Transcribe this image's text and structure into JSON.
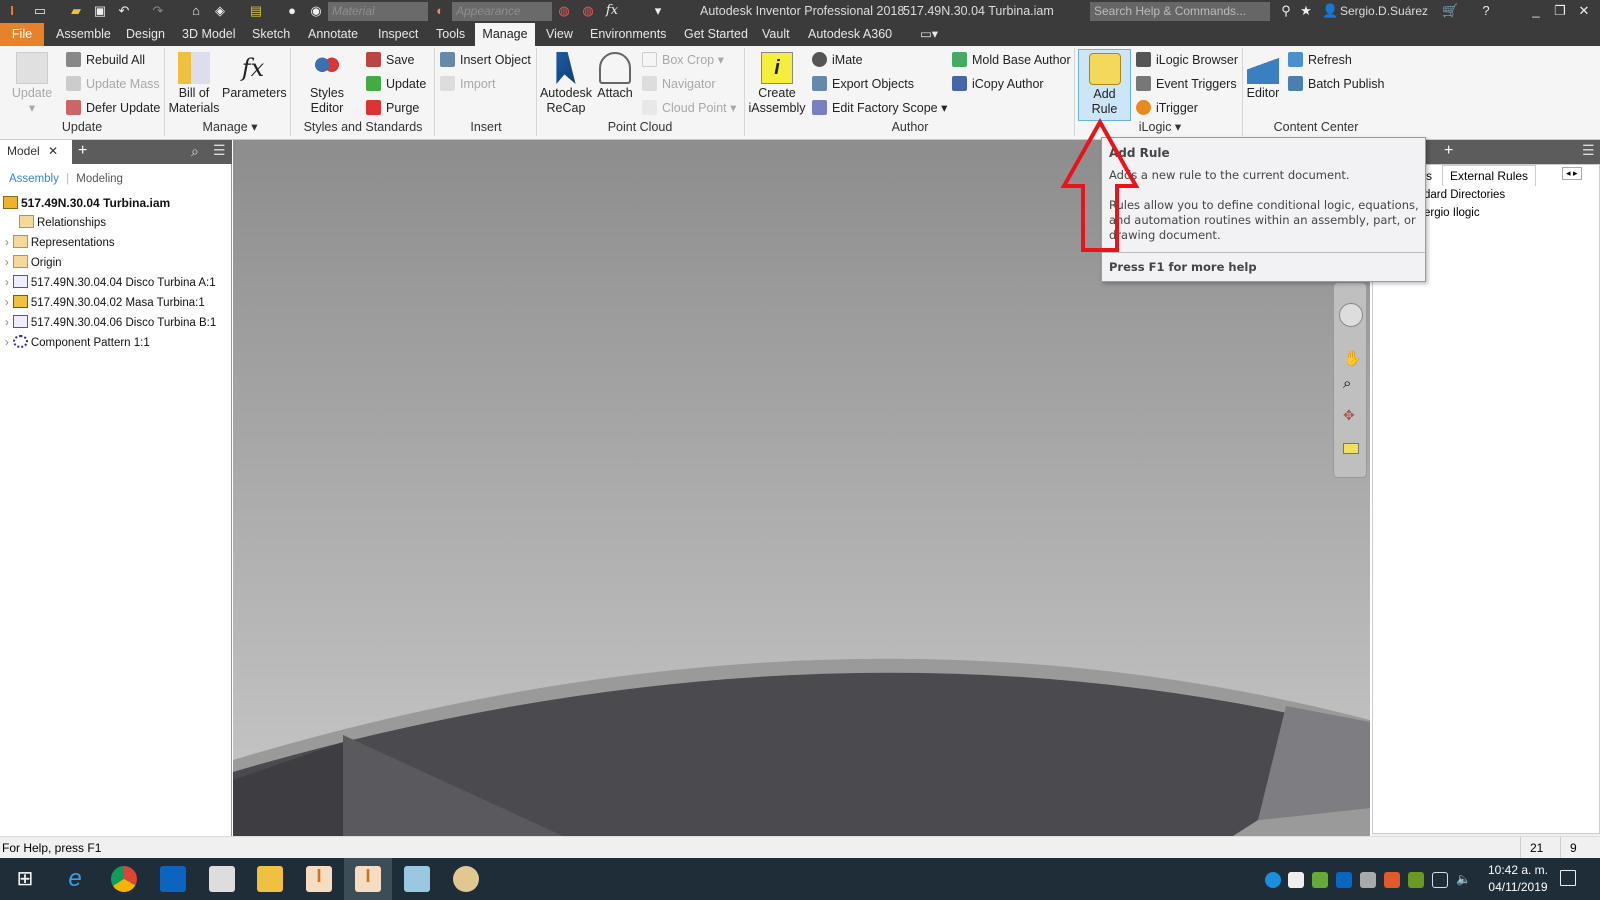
{
  "titlebar": {
    "app_title": "Autodesk Inventor Professional 2018",
    "doc_title": "517.49N.30.04 Turbina.iam",
    "material_placeholder": "Material",
    "appearance_placeholder": "Appearance",
    "search_placeholder": "Search Help & Commands...",
    "user": "Sergio.D.Suárez",
    "fx": "fx"
  },
  "tabs": [
    "File",
    "Assemble",
    "Design",
    "3D Model",
    "Sketch",
    "Annotate",
    "Inspect",
    "Tools",
    "Manage",
    "View",
    "Environments",
    "Get Started",
    "Vault",
    "Autodesk A360"
  ],
  "active_tab": "Manage",
  "ribbon": {
    "update": {
      "update": "Update",
      "rebuild_all": "Rebuild All",
      "update_mass": "Update Mass",
      "defer_update": "Defer Update",
      "label": "Update"
    },
    "manage": {
      "bom": "Bill of\nMaterials",
      "parameters": "Parameters",
      "label": "Manage"
    },
    "styles": {
      "editor": "Styles Editor",
      "save": "Save",
      "update": "Update",
      "purge": "Purge",
      "label": "Styles and Standards"
    },
    "insert": {
      "insert_object": "Insert Object",
      "import": "Import",
      "label": "Insert"
    },
    "point_cloud": {
      "recap": "Autodesk\nReCap",
      "attach": "Attach",
      "box_crop": "Box Crop",
      "navigator": "Navigator",
      "cloud_point": "Cloud Point",
      "label": "Point Cloud"
    },
    "author": {
      "create": "Create\niAssembly",
      "imate": "iMate",
      "export": "Export Objects",
      "factory": "Edit Factory Scope",
      "mold": "Mold Base Author",
      "icopy": "iCopy Author",
      "label": "Author"
    },
    "ilogic": {
      "add_rule": "Add Rule",
      "browser": "iLogic Browser",
      "event": "Event Triggers",
      "itrigger": "iTrigger",
      "label": "iLogic"
    },
    "content": {
      "editor": "Editor",
      "refresh": "Refresh",
      "batch": "Batch Publish",
      "label": "Content Center"
    }
  },
  "browser": {
    "tab": "Model",
    "view_assembly": "Assembly",
    "view_modeling": "Modeling",
    "root": "517.49N.30.04 Turbina.iam",
    "items": [
      "Relationships",
      "Representations",
      "Origin",
      "517.49N.30.04.04 Disco Turbina A:1",
      "517.49N.30.04.02 Masa Turbina:1",
      "517.49N.30.04.06 Disco Turbina B:1",
      "Component Pattern 1:1"
    ]
  },
  "tooltip": {
    "title": "Add Rule",
    "line1": "Adds a new rule to the current document.",
    "line2": "Rules allow you to define conditional logic, equations, and automation routines within an assembly, part, or drawing document.",
    "help": "Press F1 for more help"
  },
  "ilogic_panel": {
    "tab_partial": "rms",
    "tab_active": "External Rules",
    "item1": "dard Directories",
    "item2": "ergio Ilogic"
  },
  "status": {
    "help": "For Help, press F1",
    "n1": "21",
    "n2": "9"
  },
  "taskbar": {
    "time": "10:42 a. m.",
    "date": "04/11/2019"
  },
  "colors": {
    "file_tab": "#e8822a",
    "highlight": "#cde6f7",
    "arrow": "#e8141c"
  }
}
